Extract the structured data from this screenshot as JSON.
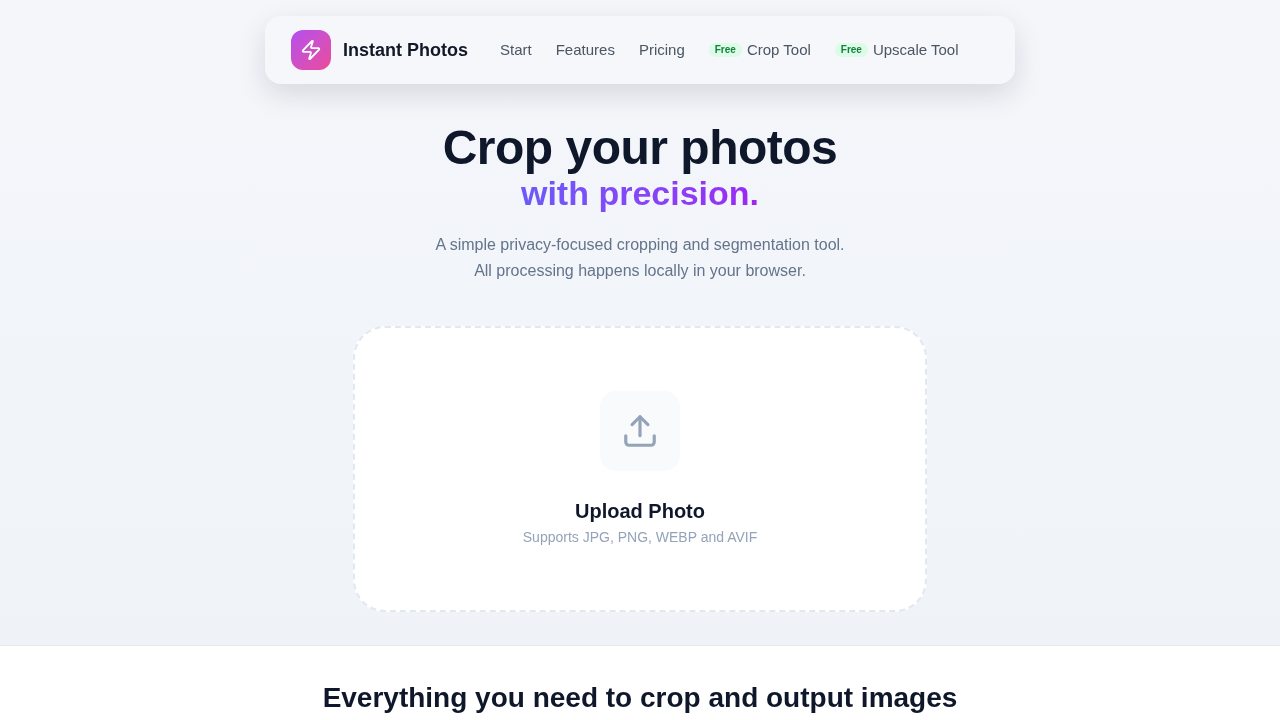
{
  "nav": {
    "brand": "Instant Photos",
    "links": [
      {
        "label": "Start"
      },
      {
        "label": "Features"
      },
      {
        "label": "Pricing"
      },
      {
        "badge": "Free",
        "label": "Crop Tool"
      },
      {
        "badge": "Free",
        "label": "Upscale Tool"
      }
    ]
  },
  "hero": {
    "title": "Crop your photos",
    "highlight": "with precision.",
    "description_lines": [
      "A simple privacy-focused cropping and segmentation tool.",
      "All processing happens locally in your browser."
    ]
  },
  "upload": {
    "title": "Upload Photo",
    "formats": "Supports JPG, PNG, WEBP and AVIF"
  },
  "features": {
    "heading": "Everything you need to crop and output images"
  }
}
